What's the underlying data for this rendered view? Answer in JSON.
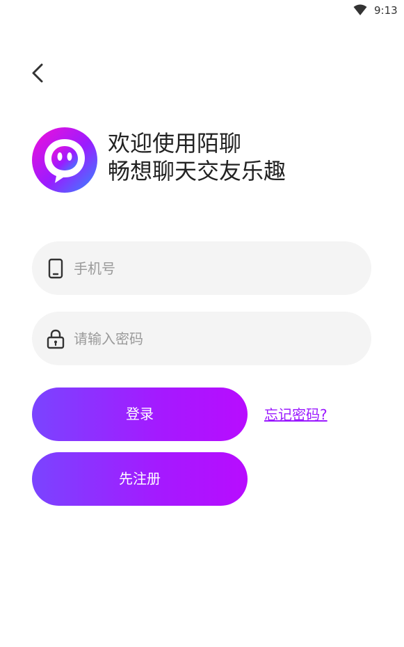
{
  "status_bar": {
    "time": "9:13",
    "wifi_icon": "wifi-icon"
  },
  "header": {
    "back_icon": "chevron-left-icon"
  },
  "brand": {
    "logo_icon": "chat-bubble-logo-icon",
    "welcome_line1": "欢迎使用陌聊",
    "welcome_line2": "畅想聊天交友乐趣"
  },
  "form": {
    "phone": {
      "icon": "phone-icon",
      "placeholder": "手机号",
      "value": ""
    },
    "password": {
      "icon": "lock-icon",
      "placeholder": "请输入密码",
      "value": ""
    }
  },
  "actions": {
    "login_label": "登录",
    "forgot_label": "忘记密码?",
    "register_label": "先注册"
  },
  "colors": {
    "accent_start": "#7a44ff",
    "accent_end": "#b80cff",
    "link": "#9b19ff",
    "field_bg": "#f4f4f4"
  }
}
